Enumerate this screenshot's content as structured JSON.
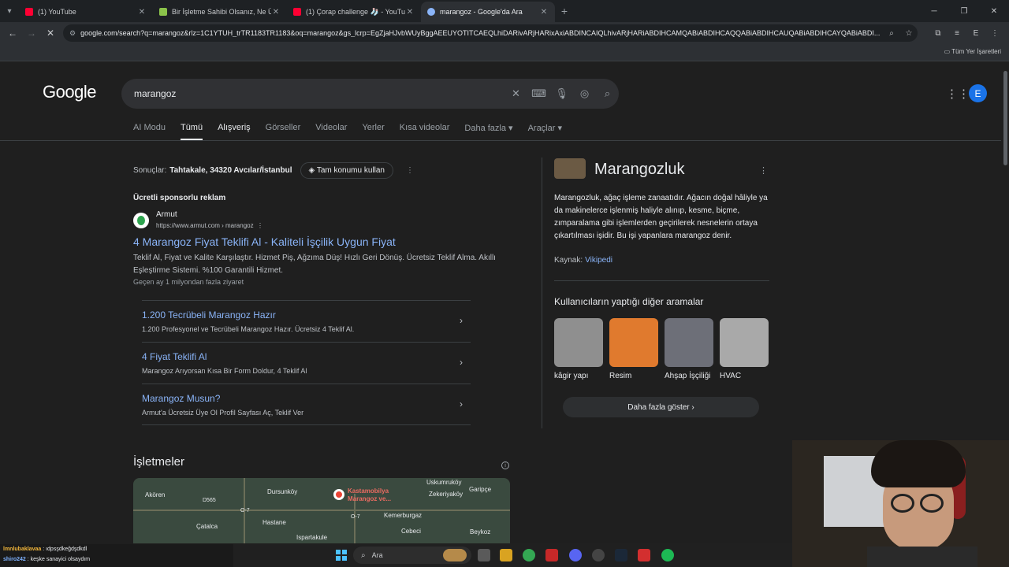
{
  "browser": {
    "tabs": [
      {
        "title": "(1) YouTube",
        "color": "#ff0033"
      },
      {
        "title": "Bir İşletme Sahibi Olsanız, Ne Ü",
        "color": "#8bc34a"
      },
      {
        "title": "(1) Çorap challenge 🧦 - YouTu",
        "color": "#ff0033"
      },
      {
        "title": "marangoz - Google'da Ara",
        "color": "#8ab4f8"
      }
    ],
    "url": "google.com/search?q=marangoz&rlz=1C1YTUH_trTR1183TR1183&oq=marangoz&gs_lcrp=EgZjaHJvbWUyBggAEEUYOTITCAEQLhiDARivARjHARixAxiABDINCAIQLhivARjHARiABDIHCAMQABiABDIHCAQQABiABDIHCAUQABiABDIHCAYQABiABDI...",
    "bookmarks_all": "Tüm Yer İşaretleri"
  },
  "google": {
    "logo": "Google",
    "query": "marangoz",
    "avatar_letter": "E",
    "nav_tabs": [
      "AI Modu",
      "Tümü",
      "Alışveriş",
      "Görseller",
      "Videolar",
      "Yerler",
      "Kısa videolar",
      "Daha fazla ▾",
      "Araçlar ▾"
    ],
    "location_prefix": "Sonuçlar:",
    "location": "Tahtakale, 34320 Avcılar/İstanbul",
    "location_button": "Tam konumu kullan",
    "sponsored_label": "Ücretli sponsorlu reklam",
    "ad": {
      "name": "Armut",
      "url": "https://www.armut.com › marangoz",
      "title": "4 Marangoz Fiyat Teklifi Al - Kaliteli İşçilik Uygun Fiyat",
      "desc": "Teklif Al, Fiyat ve Kalite Karşılaştır. Hizmet Piş, Ağzıma Düş! Hızlı Geri Dönüş. Ücretsiz Teklif Alma. Akıllı Eşleştirme Sistemi. %100 Garantili Hizmet.",
      "visits": "Geçen ay 1 milyondan fazla ziyaret",
      "sitelinks": [
        {
          "title": "1.200 Tecrübeli Marangoz Hazır",
          "desc": "1.200 Profesyonel ve Tecrübeli Marangoz Hazır. Ücretsiz 4 Teklif Al."
        },
        {
          "title": "4 Fiyat Teklifi Al",
          "desc": "Marangoz Arıyorsan Kısa Bir Form Doldur, 4 Teklif Al"
        },
        {
          "title": "Marangoz Musun?",
          "desc": "Armut'a Ücretsiz Üye Ol Profil Sayfası Aç, Teklif Ver"
        }
      ]
    },
    "businesses_heading": "İşletmeler",
    "map_labels": [
      "Akören",
      "Dursunköy",
      "Uskumruköy",
      "Garipçe",
      "Zekeriyaköy",
      "Hastane",
      "Kemerburgaz",
      "Çatalca",
      "Ispartakule",
      "Cebeci",
      "Beykoz",
      "D565",
      "O-7",
      "O-7"
    ],
    "map_pin_label": "Kastamobilya\nMarangoz ve...",
    "knowledge": {
      "title": "Marangozluk",
      "description": "Marangozluk, ağaç işleme zanaatıdır. Ağacın doğal hâliyle ya da makinelerce işlenmiş haliyle alınıp, kesme, biçme, zımparalama gibi işlemlerden geçirilerek nesnelerin ortaya çıkartılması işidir. Bu işi yapanlara marangoz denir.",
      "source_label": "Kaynak:",
      "source": "Vikipedi",
      "also_search": "Kullanıcıların yaptığı diğer aramalar",
      "related": [
        {
          "label": "kâgir yapı",
          "color": "#8f8f8f"
        },
        {
          "label": "Resim",
          "color": "#e07a2e"
        },
        {
          "label": "Ahşap İşçiliği",
          "color": "#6d6f78"
        },
        {
          "label": "HVAC",
          "color": "#a9a9a9"
        }
      ],
      "more_button": "Daha fazla göster  ›"
    }
  },
  "chat": [
    {
      "user": "lmnlubaklavaa",
      "msg": "ıdpsşdkeğdşdkdl"
    },
    {
      "user": "shiro242",
      "msg": "keşke sanayici olsaydım"
    }
  ],
  "taskbar": {
    "search_label": "Ara",
    "apps": [
      {
        "name": "file-explorer",
        "color": "#d9a321"
      },
      {
        "name": "chrome",
        "color": "#34a853"
      },
      {
        "name": "app-red",
        "color": "#c62828"
      },
      {
        "name": "discord",
        "color": "#5865f2"
      },
      {
        "name": "obs",
        "color": "#444444"
      },
      {
        "name": "steam",
        "color": "#1b2838"
      },
      {
        "name": "acrobat",
        "color": "#d32f2f"
      },
      {
        "name": "spotify",
        "color": "#1db954"
      }
    ]
  }
}
